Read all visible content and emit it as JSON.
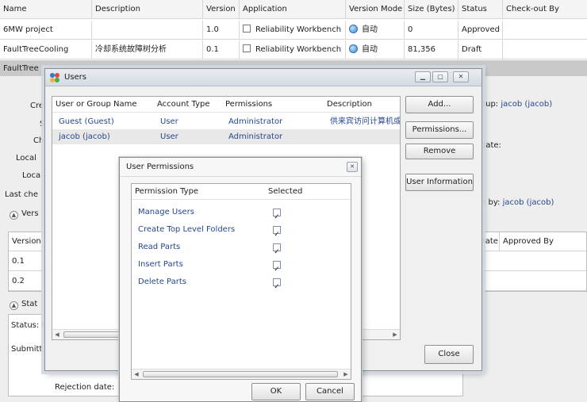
{
  "grid": {
    "columns": [
      "Name",
      "Description",
      "Version",
      "Application",
      "Version Mode",
      "Size (Bytes)",
      "Status",
      "Check-out By"
    ],
    "rows": [
      {
        "name": "6MW project",
        "description": "",
        "version": "1.0",
        "application": "Reliability Workbench",
        "version_mode": "自动",
        "size": "0",
        "status": "Approved",
        "checkout": ""
      },
      {
        "name": "FaultTreeCooling",
        "description": "冷却系统故障树分析",
        "version": "0.1",
        "application": "Reliability Workbench",
        "version_mode": "自动",
        "size": "81,356",
        "status": "Draft",
        "checkout": ""
      },
      {
        "name": "FaultTree",
        "description": "",
        "version": "",
        "application": "",
        "version_mode": "",
        "size": "",
        "status": "",
        "checkout": ""
      }
    ]
  },
  "details": {
    "cre": "Cre",
    "s": "S",
    "ch": "Ch",
    "local1": "Local",
    "local2": "Loca",
    "last_checked": "Last che",
    "versions_section": "Vers",
    "version_col": "Version",
    "version_rows": [
      "0.1",
      "0.2"
    ],
    "status_section": "Stat",
    "status_label": "Status: I",
    "submitted": "Submitt",
    "rejection_date": "Rejection date:",
    "group_label": "oup:",
    "group_value": "jacob (jacob)",
    "date_label": "date:",
    "by_label": "n by:",
    "by_value": "jacob (jacob)",
    "date_col": "Date",
    "approved_by_col": "Approved By"
  },
  "users_window": {
    "title": "Users",
    "columns": [
      "User or Group Name",
      "Account Type",
      "Permissions",
      "Description"
    ],
    "rows": [
      {
        "name": "Guest (Guest)",
        "type": "User",
        "permissions": "Administrator",
        "description": "供来宾访问计算机或"
      },
      {
        "name": "jacob (jacob)",
        "type": "User",
        "permissions": "Administrator",
        "description": ""
      }
    ],
    "buttons": {
      "add": "Add...",
      "permissions": "Permissions...",
      "remove": "Remove",
      "user_info": "User Information",
      "close": "Close"
    }
  },
  "permissions_dialog": {
    "title": "User Permissions",
    "columns": [
      "Permission Type",
      "Selected"
    ],
    "rows": [
      {
        "type": "Manage Users",
        "selected": "✓"
      },
      {
        "type": "Create Top Level Folders",
        "selected": "✓"
      },
      {
        "type": "Read Parts",
        "selected": "✓"
      },
      {
        "type": "Insert Parts",
        "selected": "✓"
      },
      {
        "type": "Delete Parts",
        "selected": "✓"
      }
    ],
    "buttons": {
      "ok": "OK",
      "cancel": "Cancel"
    }
  },
  "icons": {
    "unchecked": "checkbox-icon",
    "mode": "globe-icon",
    "users_app": "users-app-icon",
    "minimize": "minimize-icon",
    "maximize": "maximize-icon",
    "close": "close-icon",
    "collapse": "collapse-icon"
  },
  "colors": {
    "link": "#25478f",
    "selected_row": "#c9c9c9",
    "window_bg": "#f0f0f0"
  }
}
